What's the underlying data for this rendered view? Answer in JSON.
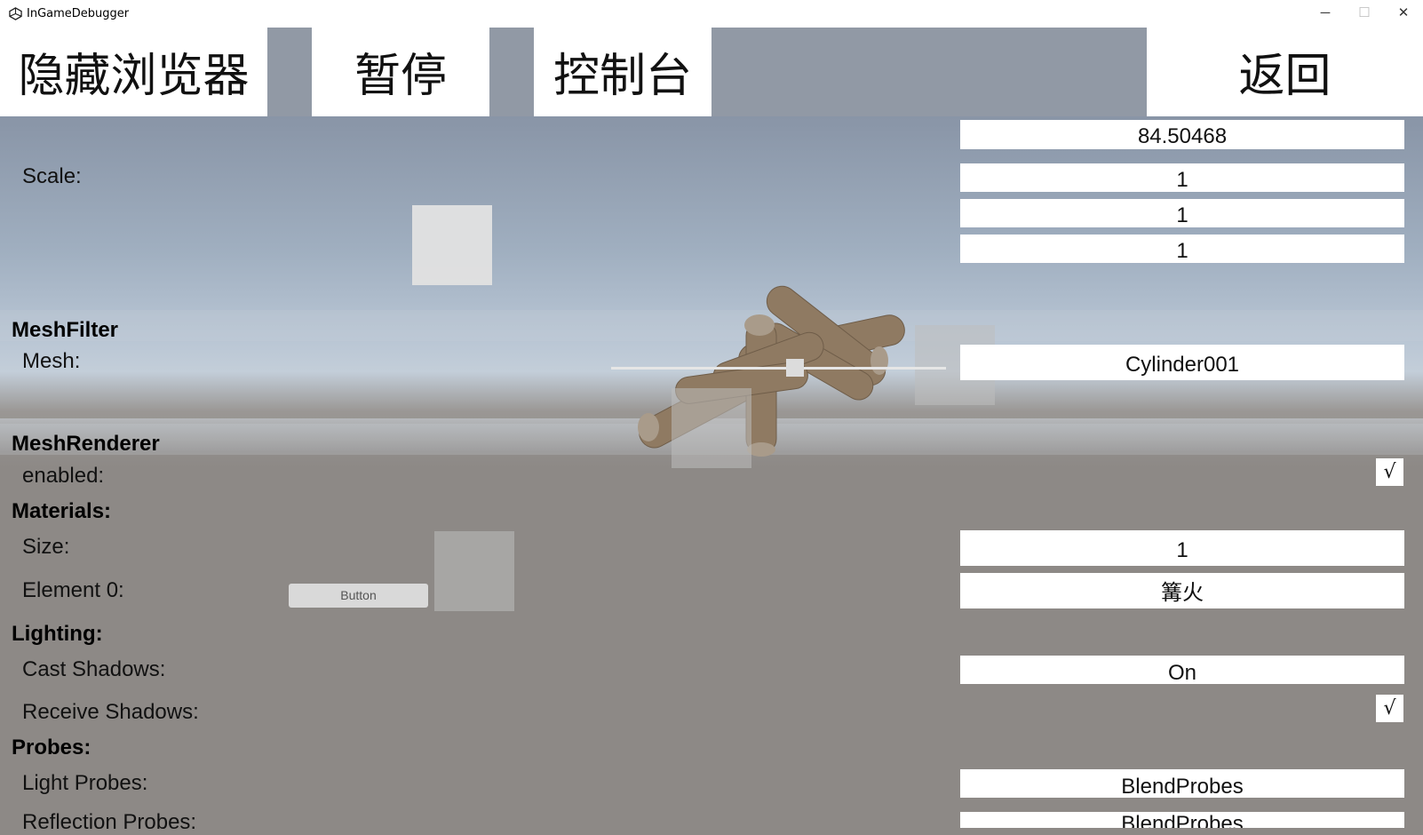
{
  "window": {
    "title": "InGameDebugger",
    "minimize_glyph": "─",
    "maximize_glyph": "☐",
    "close_glyph": "✕",
    "icon": "unity-logo-icon"
  },
  "toolbar": {
    "hide_browser_label": "隐藏浏览器",
    "pause_label": "暂停",
    "console_label": "控制台",
    "back_label": "返回"
  },
  "transform": {
    "rotation_value": "84.50468",
    "scale_label": "Scale:",
    "scale_x": "1",
    "scale_y": "1",
    "scale_z": "1"
  },
  "mesh_filter": {
    "header": "MeshFilter",
    "mesh_label": "Mesh:",
    "mesh_value": "Cylinder001"
  },
  "mesh_renderer": {
    "header": "MeshRenderer",
    "enabled_label": "enabled:",
    "enabled_check": "√",
    "materials_header": "Materials:",
    "size_label": "Size:",
    "size_value": "1",
    "element0_label": "Element 0:",
    "element0_button": "Button",
    "element0_value": "篝火",
    "lighting_header": "Lighting:",
    "cast_shadows_label": "Cast Shadows:",
    "cast_shadows_value": "On",
    "receive_shadows_label": "Receive Shadows:",
    "receive_shadows_check": "√",
    "probes_header": "Probes:",
    "light_probes_label": "Light Probes:",
    "light_probes_value": "BlendProbes",
    "reflection_probes_label": "Reflection Probes:",
    "reflection_probes_value": "BlendProbes"
  },
  "colors": {
    "sky_top": "#7c8798",
    "ground": "#8d8986",
    "toolbar_gap": "#9199a5",
    "log_wood": "#8f7a62"
  }
}
